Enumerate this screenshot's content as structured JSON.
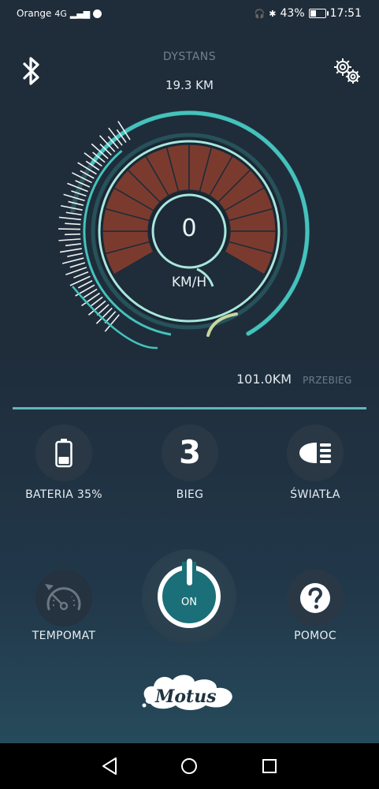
{
  "status_bar": {
    "carrier": "Orange",
    "network": "4G",
    "battery_percent": "43%",
    "battery_level": 0.43,
    "time": "17:51"
  },
  "header": {
    "distance_label": "DYSTANS",
    "distance_value": "19.3 KM",
    "bluetooth_icon": "bluetooth-icon",
    "settings_icon": "gear-icon"
  },
  "speedometer": {
    "speed": "0",
    "unit": "KM/H",
    "colors": {
      "accent": "#44c3bd",
      "segment": "#7a3b2e",
      "ring": "#a8e6dc"
    }
  },
  "odometer": {
    "value": "101.0KM",
    "label": "PRZEBIEG"
  },
  "controls": {
    "battery": {
      "label": "BATERIA 35%",
      "level": 0.35,
      "icon": "battery-icon"
    },
    "gear": {
      "label": "BIEG",
      "value": "3"
    },
    "lights": {
      "label": "ŚWIATŁA",
      "icon": "headlight-icon"
    },
    "cruise": {
      "label": "TEMPOMAT",
      "icon": "speedometer-icon"
    },
    "power": {
      "label": "ON",
      "icon": "power-icon"
    },
    "help": {
      "label": "POMOC",
      "icon": "question-icon"
    }
  },
  "logo": {
    "text": "Motus"
  },
  "nav": {
    "back": "back-icon",
    "home": "home-icon",
    "recent": "recent-apps-icon"
  }
}
